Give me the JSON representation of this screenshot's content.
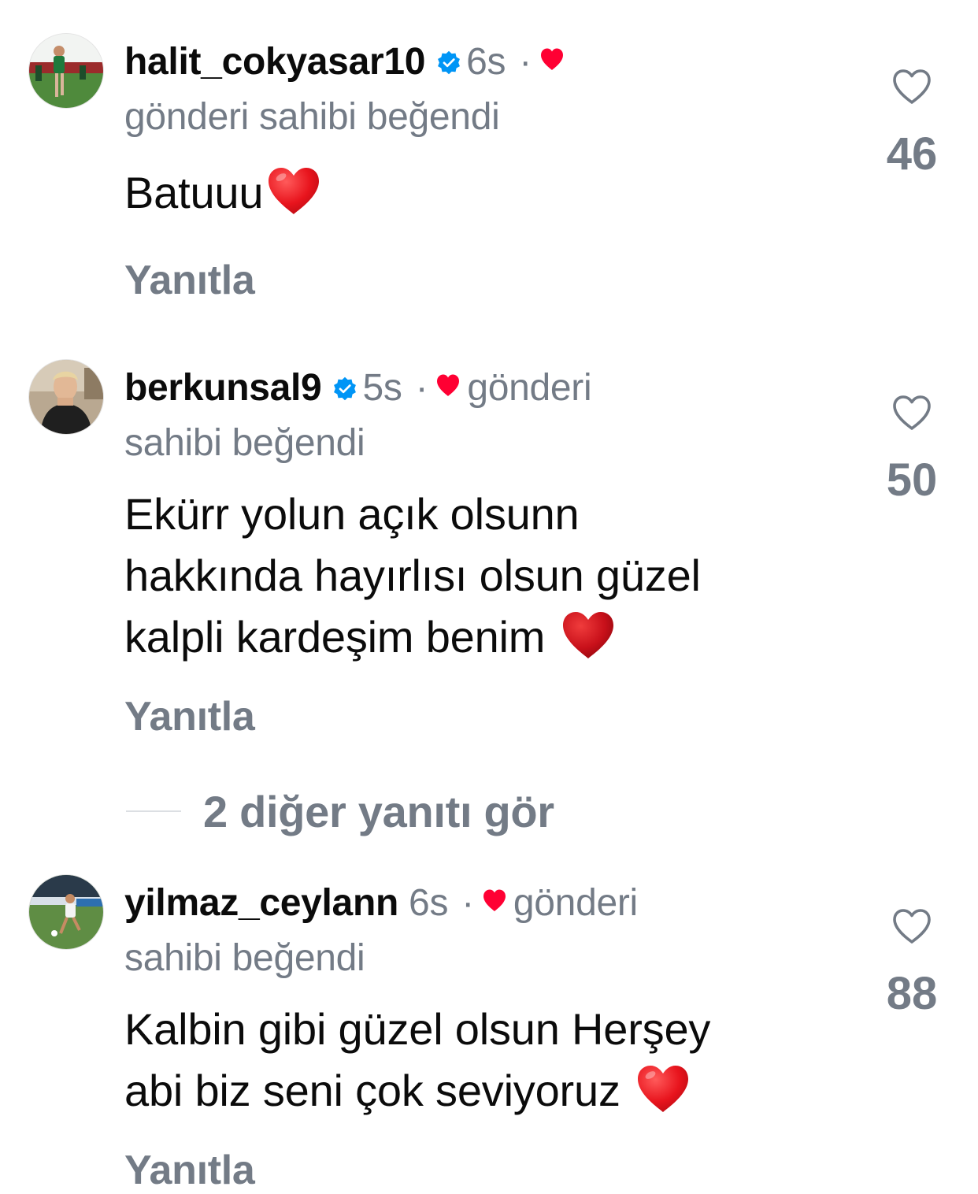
{
  "comments": [
    {
      "username": "halit_cokyasar10",
      "verified": true,
      "time": "6s",
      "separator": "·",
      "liked_by_author": "gönderi sahibi beğendi",
      "text": "Batuuu",
      "emoji": "heart-emoji",
      "reply_label": "Yanıtla",
      "like_count": "46"
    },
    {
      "username": "berkunsal9",
      "verified": true,
      "time": "5s",
      "separator": "·",
      "liked_by_author_line1": "gönderi",
      "liked_by_author_line2": "sahibi beğendi",
      "text_lines": [
        "Ekürr yolun açık olsunn",
        "hakkında hayırlısı olsun güzel",
        "kalpli kardeşim benim"
      ],
      "emoji": "heart-emoji",
      "reply_label": "Yanıtla",
      "like_count": "50"
    },
    {
      "username": "yilmaz_ceylann",
      "verified": false,
      "time": "6s",
      "separator": "·",
      "liked_by_author_line1": "gönderi",
      "liked_by_author_line2": "sahibi beğendi",
      "text_lines": [
        "Kalbin gibi güzel olsun Herşey",
        "abi biz seni çok seviyoruz"
      ],
      "emoji": "heart-emoji",
      "reply_label": "Yanıtla",
      "like_count": "88"
    }
  ],
  "more_replies": {
    "label": "2 diğer yanıtı gör"
  },
  "colors": {
    "verified_badge": "#0095f6",
    "author_heart": "#ff0033",
    "secondary_text": "#737b86",
    "primary_text": "#0b0b0b"
  }
}
